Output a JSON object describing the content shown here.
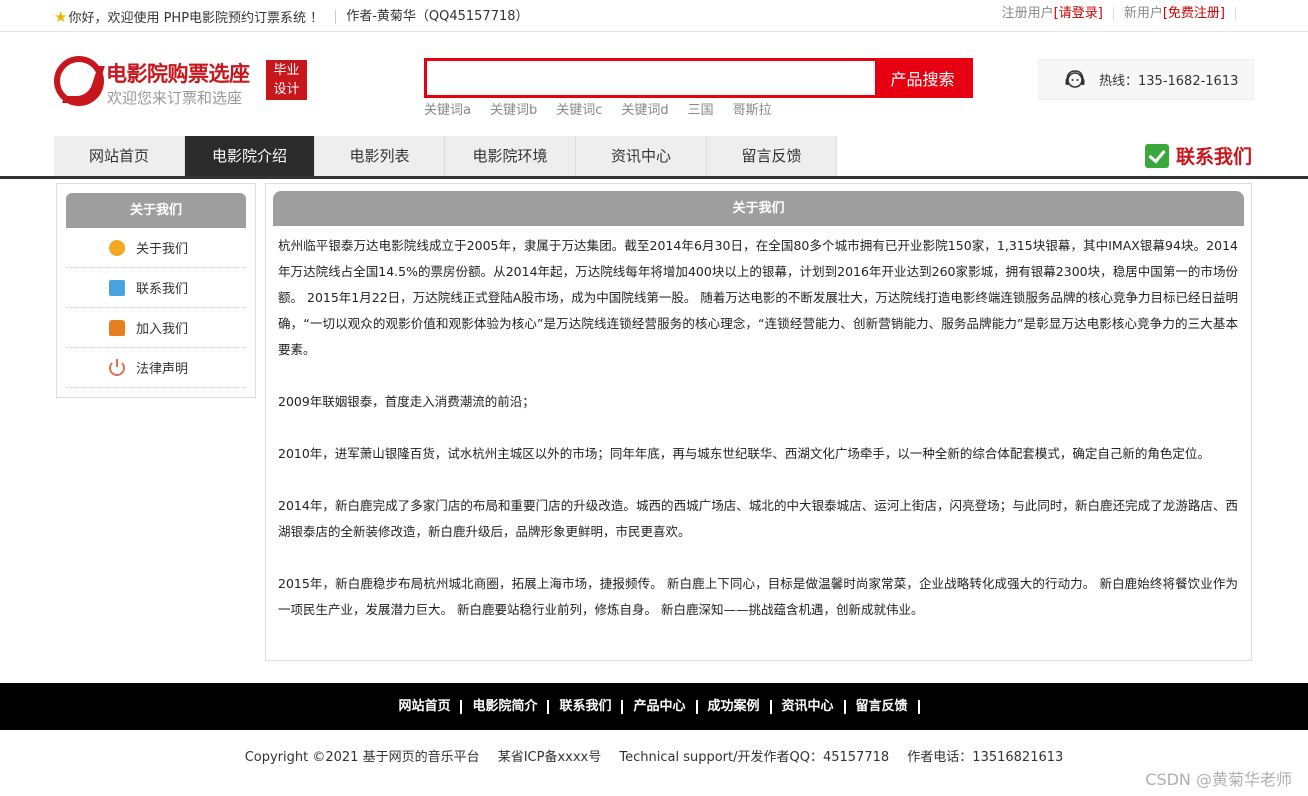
{
  "topbar": {
    "welcome": "你好，欢迎使用 PHP电影院预约订票系统 ！",
    "author": "作者-黄菊华（QQ45157718）",
    "registered_prefix": "注册用户",
    "login_link": "[请登录]",
    "new_prefix": "新用户",
    "register_link": "[免费注册]"
  },
  "header": {
    "site_title": "电影院购票选座",
    "site_subtitle": "欢迎您来订票和选座",
    "badge_line1": "毕业",
    "badge_line2": "设计",
    "search_placeholder": "",
    "search_button": "产品搜索",
    "keywords": [
      "关键词a",
      "关键词b",
      "关键词c",
      "关键词d",
      "三国",
      "哥斯拉"
    ],
    "hotline": "热线：135-1682-1613"
  },
  "nav": {
    "items": [
      {
        "label": "网站首页",
        "width": 131
      },
      {
        "label": "电影院介绍",
        "width": 130,
        "active": true
      },
      {
        "label": "电影列表",
        "width": 130
      },
      {
        "label": "电影院环境",
        "width": 131
      },
      {
        "label": "资讯中心",
        "width": 131
      },
      {
        "label": "留言反馈",
        "width": 130
      }
    ],
    "contact": "联系我们"
  },
  "sidebar": {
    "title": "关于我们",
    "items": [
      {
        "label": "关于我们",
        "icon": "about-icon"
      },
      {
        "label": "联系我们",
        "icon": "contact-icon"
      },
      {
        "label": "加入我们",
        "icon": "lock-icon"
      },
      {
        "label": "法律声明",
        "icon": "power-icon"
      }
    ]
  },
  "main": {
    "title": "关于我们",
    "paragraphs": [
      "杭州临平银泰万达电影院线成立于2005年，隶属于万达集团。截至2014年6月30日，在全国80多个城市拥有已开业影院150家，1,315块银幕，其中IMAX银幕94块。2014年万达院线占全国14.5%的票房份额。从2014年起，万达院线每年将增加400块以上的银幕，计划到2016年开业达到260家影城，拥有银幕2300块，稳居中国第一的市场份额。 2015年1月22日，万达院线正式登陆A股市场，成为中国院线第一股。 随着万达电影的不断发展壮大，万达院线打造电影终端连锁服务品牌的核心竞争力目标已经日益明确，“一切以观众的观影价值和观影体验为核心”是万达院线连锁经营服务的核心理念，“连锁经营能力、创新营销能力、服务品牌能力”是彰显万达电影核心竞争力的三大基本要素。",
      "2009年联姻银泰，首度走入消费潮流的前沿；",
      "2010年，进军萧山银隆百货，试水杭州主城区以外的市场；同年年底，再与城东世纪联华、西湖文化广场牵手，以一种全新的综合体配套模式，确定自己新的角色定位。",
      "2014年，新白鹿完成了多家门店的布局和重要门店的升级改造。城西的西城广场店、城北的中大银泰城店、运河上街店，闪亮登场；与此同时，新白鹿还完成了龙游路店、西湖银泰店的全新装修改造，新白鹿升级后，品牌形象更鲜明，市民更喜欢。",
      "2015年，新白鹿稳步布局杭州城北商圈，拓展上海市场，捷报频传。 新白鹿上下同心，目标是做温馨时尚家常菜，企业战略转化成强大的行动力。 新白鹿始终将餐饮业作为一项民生产业，发展潜力巨大。 新白鹿要站稳行业前列，修炼自身。 新白鹿深知——挑战蕴含机遇，创新成就伟业。"
    ]
  },
  "footer": {
    "links": [
      "网站首页",
      "电影院简介",
      "联系我们",
      "产品中心",
      "成功案例",
      "资讯中心",
      "留言反馈"
    ],
    "copyright": "Copyright ©2021 基于网页的音乐平台",
    "icp": "某省ICP备xxxx号",
    "support": "Technical support/开发作者QQ：45157718",
    "phone": "作者电话：13516821613"
  },
  "watermark": "CSDN @黄菊华老师"
}
